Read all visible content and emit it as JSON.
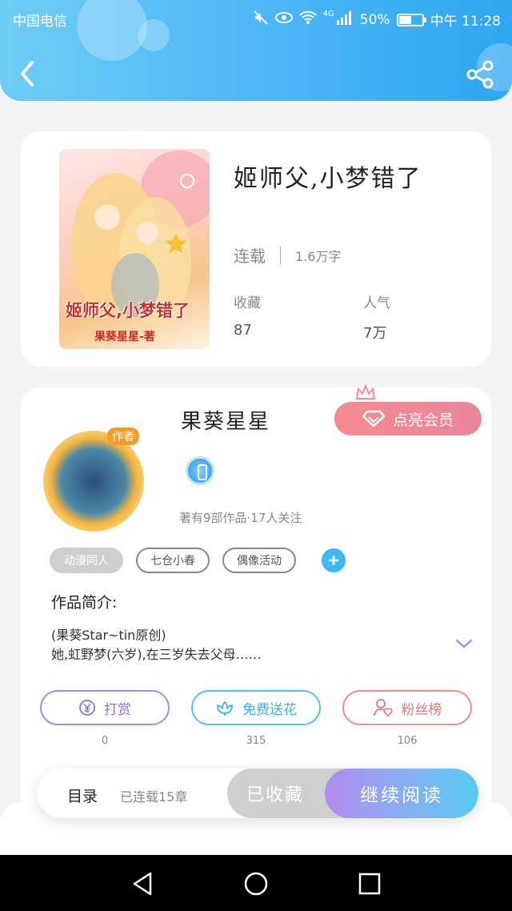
{
  "status_bar": {
    "carrier": "中国电信",
    "network": "4G",
    "battery": "50%",
    "time": "中午 11:28"
  },
  "book": {
    "title": "姬师父,小梦错了",
    "cover_title": "姬师父,小梦错了",
    "cover_author": "果葵星星-著",
    "status": "连载",
    "word_count": "1.6万字",
    "favorites_label": "收藏",
    "favorites_value": "87",
    "popularity_label": "人气",
    "popularity_value": "7万"
  },
  "author": {
    "name": "果葵星星",
    "avatar_badge": "作者",
    "vip_button": "点亮会员",
    "meta": "著有9部作品·17人关注",
    "tags": [
      "动漫同人",
      "七仓小春",
      "偶像活动"
    ]
  },
  "intro": {
    "title": "作品简介:",
    "line1": "(果葵Star~tin原创)",
    "line2": "她,虹野梦(六岁),在三岁失去父母……"
  },
  "actions": {
    "tip_label": "打赏",
    "tip_count": "0",
    "flower_label": "免费送花",
    "flower_count": "315",
    "fans_label": "粉丝榜",
    "fans_count": "106"
  },
  "bottom_bar": {
    "toc_label": "目录",
    "chapter_count": "已连载15章",
    "favorited_label": "已收藏",
    "read_label": "继续阅读"
  }
}
